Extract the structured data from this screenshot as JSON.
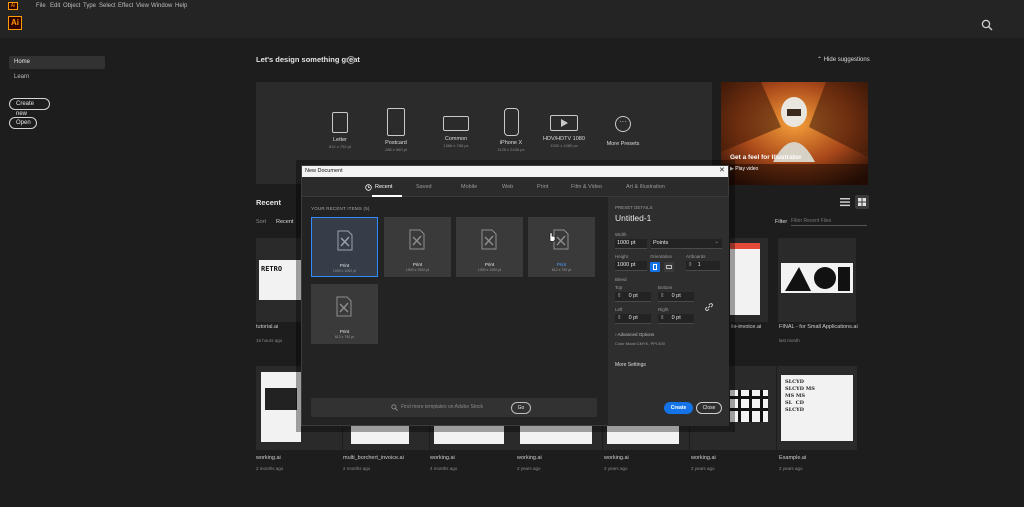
{
  "app": {
    "logo_text": "Ai",
    "menus": [
      "File",
      "Edit",
      "Object",
      "Type",
      "Select",
      "Effect",
      "View",
      "Window",
      "Help"
    ]
  },
  "nav": {
    "home": "Home",
    "learn": "Learn",
    "create_new": "Create new",
    "open": "Open"
  },
  "home": {
    "heading": "Let's design something great",
    "hide_suggestions": "Hide suggestions",
    "presets": [
      {
        "label": "Letter",
        "size": "612 x 792 pt",
        "icon": "letter-page-icon"
      },
      {
        "label": "Postcard",
        "size": "288 x 560 pt",
        "icon": "postcard-brush-icon"
      },
      {
        "label": "Common",
        "size": "1366 x 768 px",
        "icon": "common-screen-icon"
      },
      {
        "label": "iPhone X",
        "size": "1125 x 2436 px",
        "icon": "phone-icon"
      },
      {
        "label": "HDV/HDTV 1080",
        "size": "1920 x 1080 px",
        "icon": "video-play-icon"
      },
      {
        "label": "More Presets",
        "size": "",
        "icon": "more-icon"
      }
    ],
    "promo": {
      "title": "Get a feel for Illustrator",
      "play_label": "Play video"
    }
  },
  "recent": {
    "heading": "Recent",
    "sort_label": "Sort",
    "sort_value": "Recent",
    "filter_label": "Filter",
    "filter_placeholder": "Filter Recent Files",
    "files_row1": [
      {
        "name": "tutorial.ai",
        "time": "16 hours ago"
      },
      {
        "name": "ile-invoice.ai",
        "time": ""
      },
      {
        "name": "FINAL - for Small Applications.ai",
        "time": "last month"
      }
    ],
    "files_row2": [
      {
        "name": "working.ai",
        "time": "2 months ago"
      },
      {
        "name": "multi_borchert_invoice.ai",
        "time": "2 months ago"
      },
      {
        "name": "working.ai",
        "time": "4 months ago"
      },
      {
        "name": "working.ai",
        "time": "2 years ago"
      },
      {
        "name": "working.ai",
        "time": "2 years ago"
      },
      {
        "name": "working.ai",
        "time": "2 years ago"
      },
      {
        "name": "Example.ai",
        "time": "2 years ago"
      }
    ]
  },
  "dialog": {
    "title": "New Document",
    "close_glyph": "✕",
    "tabs": [
      "Recent",
      "Saved",
      "Mobile",
      "Web",
      "Print",
      "Film & Video",
      "Art & Illustration"
    ],
    "recent_items_label": "YOUR RECENT ITEMS (5)",
    "tiles": [
      {
        "name": "Print",
        "size": "1000 x 1000 pt"
      },
      {
        "name": "Print",
        "size": "1500 x 2500 pt"
      },
      {
        "name": "Print",
        "size": "1000 x 1000 pt"
      },
      {
        "name": "Print",
        "size": "612 x 792 pt"
      },
      {
        "name": "Print",
        "size": "612 x 792 pt"
      }
    ],
    "template_search": "Find more templates on Adobe Stock",
    "go": "Go",
    "details": {
      "section_label": "PRESET DETAILS",
      "name": "Untitled-1",
      "width_label": "Width",
      "width_value": "1000 pt",
      "units_value": "Points",
      "height_label": "Height",
      "height_value": "1000 pt",
      "orientation_label": "Orientation",
      "artboards_label": "Artboards",
      "artboards_value": "1",
      "bleed_label": "Bleed",
      "top_label": "Top",
      "top_value": "0 pt",
      "bottom_label": "Bottom",
      "bottom_value": "0 pt",
      "left_label": "Left",
      "left_value": "0 pt",
      "right_label": "Right",
      "right_value": "0 pt",
      "advanced_label": "Advanced Options",
      "color_label": "Color Mode:CMYK, PPI:300",
      "more_settings": "More Settings",
      "create": "Create",
      "close": "Close"
    }
  }
}
